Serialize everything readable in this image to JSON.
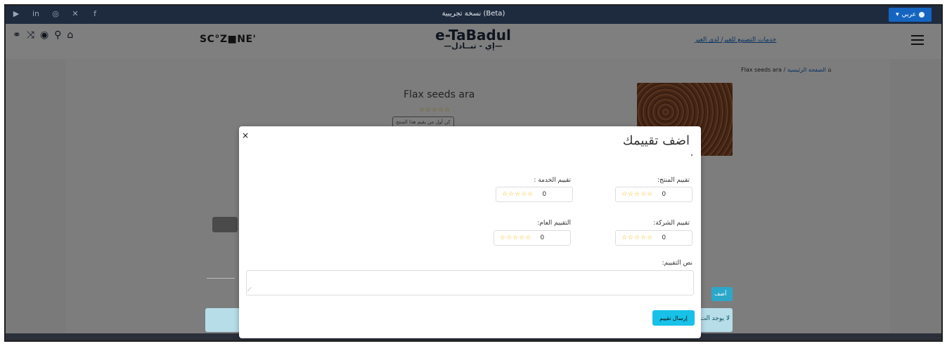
{
  "topbar": {
    "social_icons": [
      "youtube-icon",
      "linkedin-icon",
      "instagram-icon",
      "x-icon",
      "facebook-icon"
    ],
    "beta_label": "نسخة تجريبية (Beta)",
    "language_label": "عربي"
  },
  "header": {
    "sczone_label": "SC°Z■NE'",
    "logo_en": "e-TaBadul",
    "logo_ar": "—إي - تبــادل—",
    "link_text": "خدمات التصنيع للغير/ لدى الغير"
  },
  "product": {
    "breadcrumb_home": "الصفحة الرئيسية",
    "breadcrumb_separator": "/",
    "breadcrumb_current": "Flax seeds ara",
    "name": "Flax seeds ara",
    "stars": "☆☆☆☆☆",
    "first_review_label": "كن أول من يقيم هذا المنتج"
  },
  "background": {
    "add_review_partial": "أضف تقيي",
    "no_reviews_partial": "لا يوجد الت"
  },
  "modal": {
    "title": "اضف تقييمك",
    "close": "×",
    "product_rating_label": "تقييم المنتج:",
    "service_rating_label": "تقييم الخدمة :",
    "company_rating_label": "تقييم الشركة:",
    "overall_rating_label": "التقييم العام:",
    "stars": "☆☆☆☆☆",
    "product_rating_value": "0",
    "service_rating_value": "0",
    "company_rating_value": "0",
    "overall_rating_value": "0",
    "review_text_label": "نص التقييم:",
    "review_text_value": "",
    "submit_label": "إرسال تقييم"
  },
  "colors": {
    "topbar_bg": "#1e2b3f",
    "accent_blue": "#1565c0",
    "submit_cyan": "#17c1e8",
    "star_color": "#f4b400"
  }
}
